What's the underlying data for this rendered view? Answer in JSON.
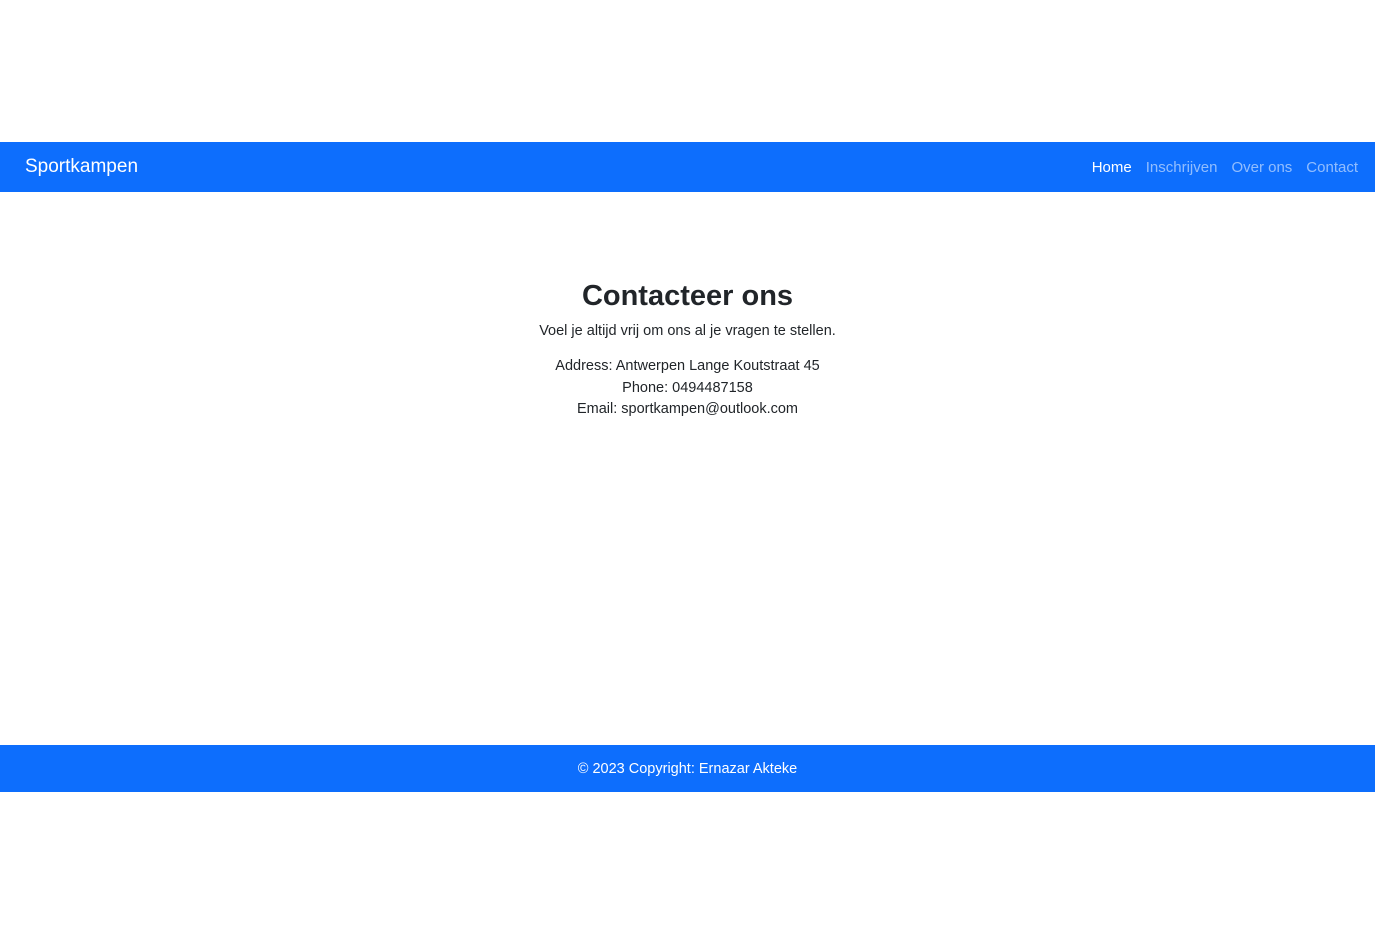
{
  "navbar": {
    "brand": "Sportkampen",
    "links": [
      {
        "label": "Home",
        "active": true
      },
      {
        "label": "Inschrijven",
        "active": false
      },
      {
        "label": "Over ons",
        "active": false
      },
      {
        "label": "Contact",
        "active": false
      }
    ]
  },
  "main": {
    "title": "Contacteer ons",
    "subtitle": "Voel je altijd vrij om ons al je vragen te stellen.",
    "address": "Address: Antwerpen Lange Koutstraat 45",
    "phone": "Phone: 0494487158",
    "email": "Email: sportkampen@outlook.com"
  },
  "footer": {
    "text": "© 2023 Copyright: Ernazar Akteke"
  },
  "colors": {
    "primary": "#0d6efd",
    "text": "#212529"
  }
}
